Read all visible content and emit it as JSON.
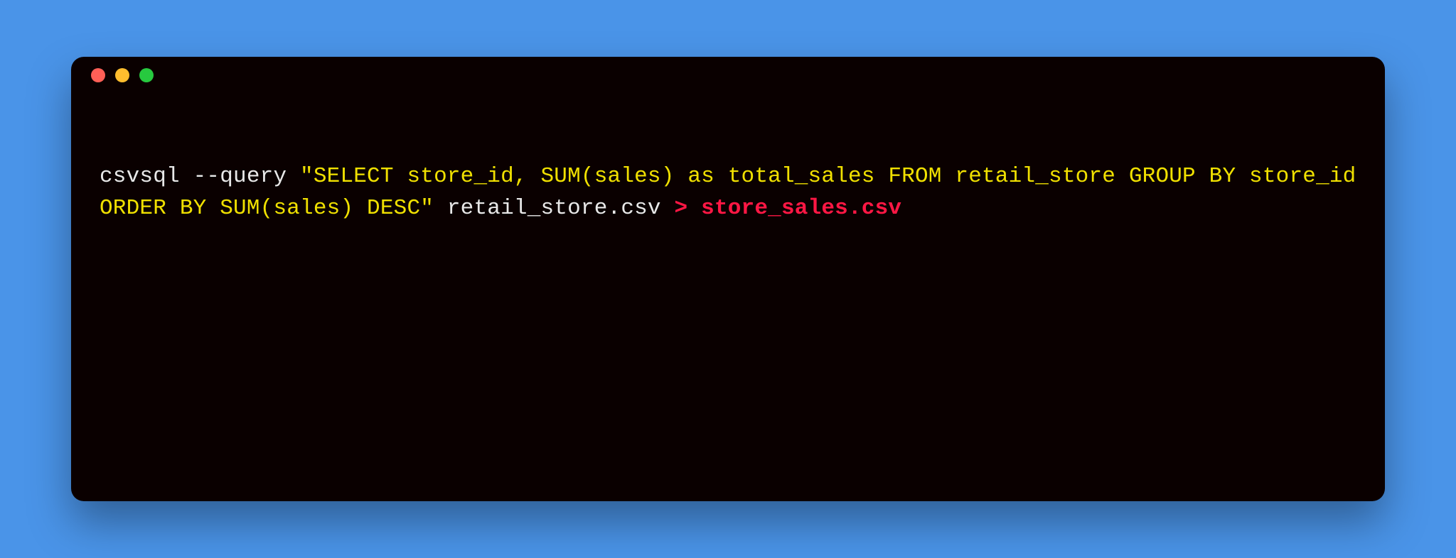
{
  "terminal": {
    "tokens": {
      "cmd_part1": "csvsql --query ",
      "sql_string": "\"SELECT store_id, SUM(sales) as total_sales FROM retail_store GROUP BY store_id ORDER BY SUM(sales) DESC\"",
      "cmd_part2": " retail_store.csv ",
      "redirect": "> store_sales.csv"
    }
  }
}
